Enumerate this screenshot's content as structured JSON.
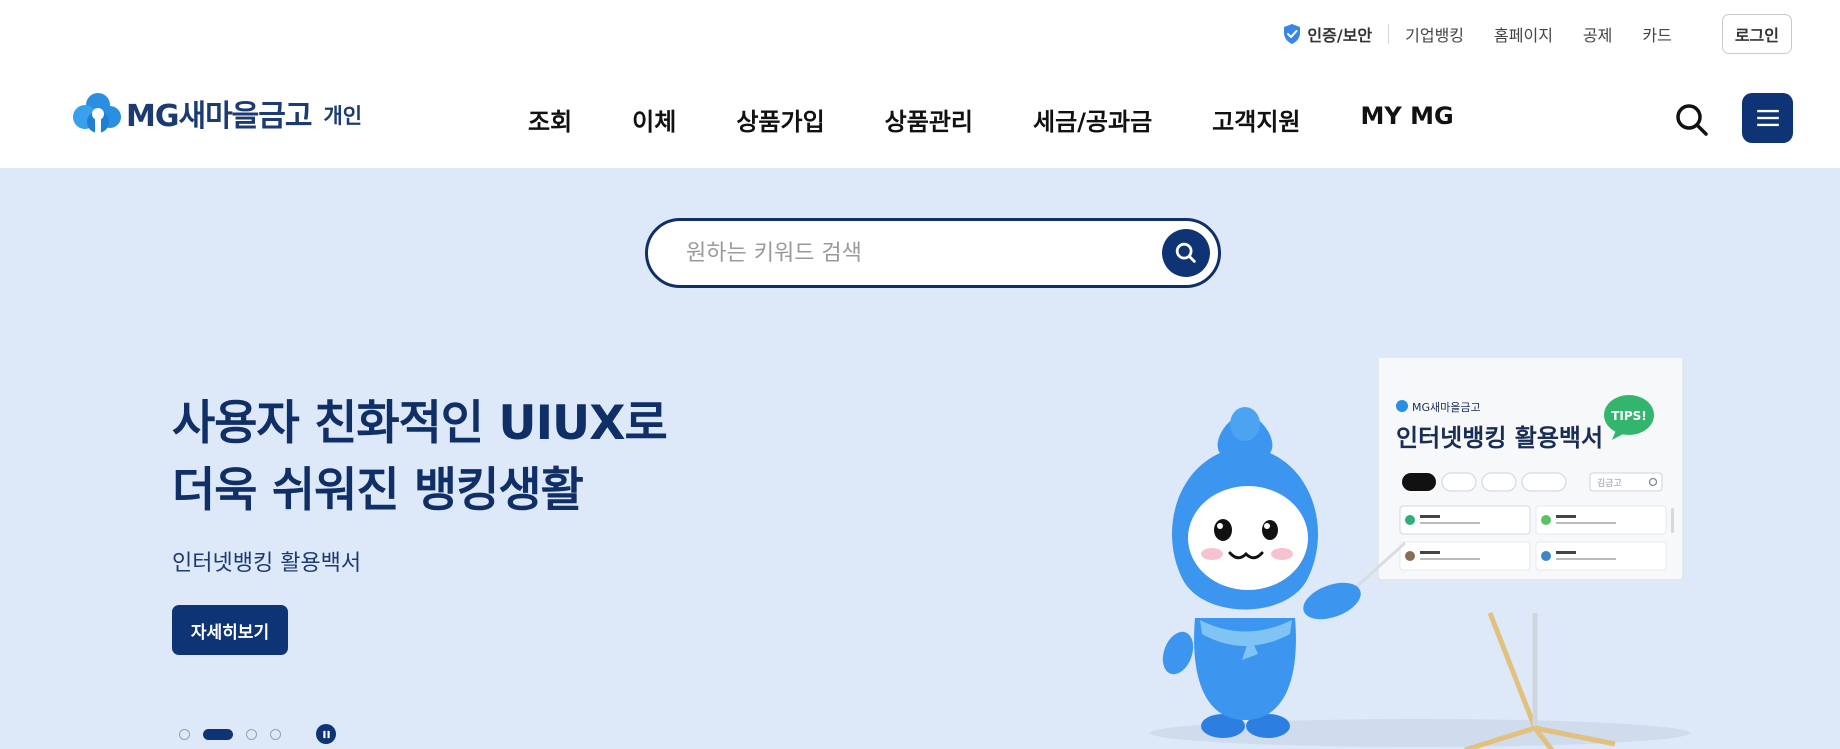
{
  "utility": {
    "cert_label": "인증/보안",
    "links": [
      "기업뱅킹",
      "홈페이지",
      "공제",
      "카드"
    ],
    "login_label": "로그인"
  },
  "header": {
    "logo_text": "MG새마을금고",
    "logo_sub": "개인",
    "nav": [
      "조회",
      "이체",
      "상품가입",
      "상품관리",
      "세금/공과금",
      "고객지원",
      "MY MG"
    ]
  },
  "hero": {
    "search_placeholder": "원하는 키워드 검색",
    "title_line1": "사용자 친화적인 UIUX로",
    "title_line2": "더욱 쉬워진 뱅킹생활",
    "subtitle": "인터넷뱅킹 활용백서",
    "cta_label": "자세히보기",
    "slides_count": 4,
    "active_slide": 2,
    "board": {
      "brand": "MG새마을금고",
      "title": "인터넷뱅킹 활용백서",
      "badge": "TIPS!",
      "search_text": "김금고"
    }
  },
  "colors": {
    "brand_navy": "#0f3476",
    "hero_bg": "#dde9f9",
    "logo_blue": "#2a8fe0"
  },
  "icons": [
    "shield-icon",
    "search-icon",
    "hamburger-menu-icon",
    "pause-icon",
    "mascot-illustration"
  ]
}
